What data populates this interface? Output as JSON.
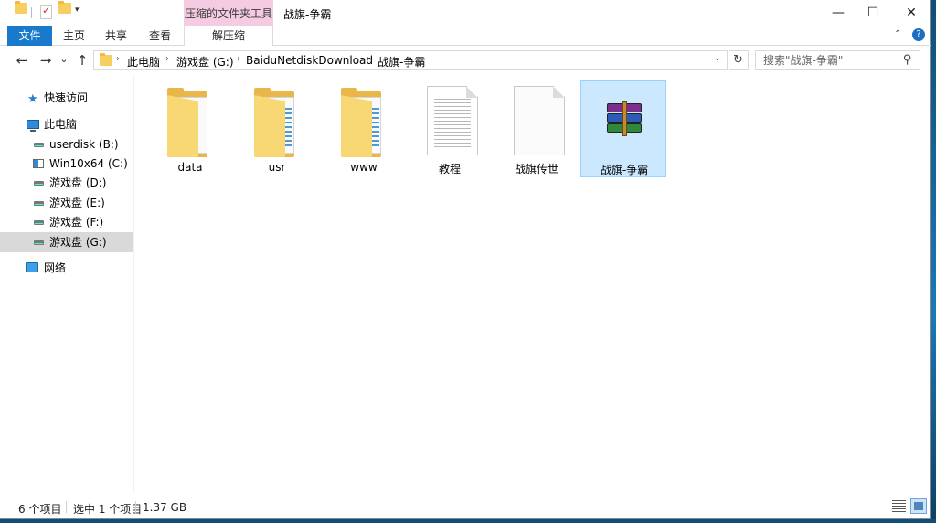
{
  "window": {
    "title": "战旗-争霸",
    "context_tools_title": "压缩的文件夹工具",
    "minimize_glyph": "—",
    "maximize_glyph": "☐",
    "close_glyph": "✕"
  },
  "ribbon": {
    "tabs": [
      "文件",
      "主页",
      "共享",
      "查看",
      "解压缩"
    ],
    "collapse_glyph": "⌃",
    "help_glyph": "?"
  },
  "nav": {
    "back_glyph": "←",
    "forward_glyph": "→",
    "recent_glyph": "⌄",
    "up_glyph": "↑",
    "breadcrumbs": [
      "此电脑",
      "游戏盘 (G:)",
      "BaiduNetdiskDownload",
      "战旗-争霸"
    ],
    "crumb_sep": "›",
    "dropdown_glyph": "⌄",
    "refresh_glyph": "↻",
    "search_placeholder": "搜索\"战旗-争霸\"",
    "search_glyph": "⚲"
  },
  "sidebar": {
    "quick_access": "快速访问",
    "this_pc": "此电脑",
    "drives": [
      "userdisk (B:)",
      "Win10x64 (C:)",
      "游戏盘 (D:)",
      "游戏盘 (E:)",
      "游戏盘 (F:)",
      "游戏盘 (G:)"
    ],
    "selected_drive": "游戏盘 (G:)",
    "network": "网络"
  },
  "files": [
    {
      "name": "data",
      "type": "folder-icon"
    },
    {
      "name": "usr",
      "type": "folder-icon"
    },
    {
      "name": "www",
      "type": "folder-icon"
    },
    {
      "name": "教程",
      "type": "text-document-icon"
    },
    {
      "name": "战旗传世",
      "type": "blank-document-icon"
    },
    {
      "name": "战旗-争霸",
      "type": "rar-archive-icon",
      "selected": true
    }
  ],
  "status": {
    "item_count": "6 个项目",
    "selection": "选中 1 个项目",
    "size": "1.37 GB"
  },
  "colors": {
    "file_tab": "#1979ca",
    "context_tab": "#f4cbe0",
    "selection": "#cce8ff",
    "folder": "#f8d775"
  }
}
